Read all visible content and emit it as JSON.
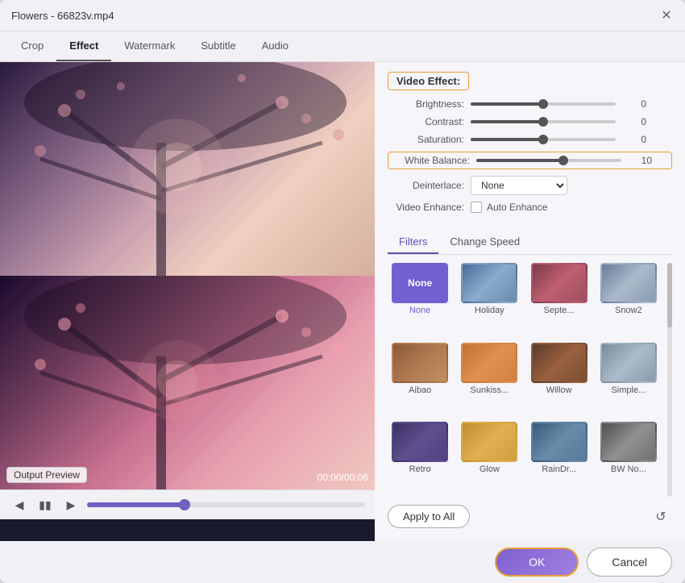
{
  "window": {
    "title": "Flowers - 66823v.mp4"
  },
  "tabs": [
    {
      "id": "crop",
      "label": "Crop",
      "active": false
    },
    {
      "id": "effect",
      "label": "Effect",
      "active": true
    },
    {
      "id": "watermark",
      "label": "Watermark",
      "active": false
    },
    {
      "id": "subtitle",
      "label": "Subtitle",
      "active": false
    },
    {
      "id": "audio",
      "label": "Audio",
      "active": false
    }
  ],
  "video_effect": {
    "section_title": "Video Effect:",
    "brightness": {
      "label": "Brightness:",
      "value": 0,
      "percent": 50
    },
    "contrast": {
      "label": "Contrast:",
      "value": 0,
      "percent": 50
    },
    "saturation": {
      "label": "Saturation:",
      "value": 0,
      "percent": 50
    },
    "white_balance": {
      "label": "White Balance:",
      "value": 10,
      "percent": 60
    },
    "deinterlace": {
      "label": "Deinterlace:",
      "options": [
        "None"
      ],
      "selected": "None"
    },
    "video_enhance": {
      "label": "Video Enhance:",
      "checkbox_label": "Auto Enhance"
    }
  },
  "filters": {
    "tab_filters": "Filters",
    "tab_change_speed": "Change Speed",
    "items": [
      {
        "id": "none",
        "name": "None",
        "selected": true,
        "type": "none"
      },
      {
        "id": "holiday",
        "name": "Holiday",
        "selected": false,
        "type": "holiday"
      },
      {
        "id": "septe",
        "name": "Septe...",
        "selected": false,
        "type": "septe"
      },
      {
        "id": "snow2",
        "name": "Snow2",
        "selected": false,
        "type": "snow2"
      },
      {
        "id": "aibao",
        "name": "Aibao",
        "selected": false,
        "type": "aibao"
      },
      {
        "id": "sunkiss",
        "name": "Sunkiss...",
        "selected": false,
        "type": "sunkiss"
      },
      {
        "id": "willow",
        "name": "Willow",
        "selected": false,
        "type": "willow"
      },
      {
        "id": "simple",
        "name": "Simple...",
        "selected": false,
        "type": "simple"
      },
      {
        "id": "retro",
        "name": "Retro",
        "selected": false,
        "type": "retro"
      },
      {
        "id": "glow",
        "name": "Glow",
        "selected": false,
        "type": "glow"
      },
      {
        "id": "raindr",
        "name": "RainDr...",
        "selected": false,
        "type": "raindr"
      },
      {
        "id": "bwno",
        "name": "BW No...",
        "selected": false,
        "type": "bwno"
      }
    ]
  },
  "preview": {
    "output_label": "Output Preview",
    "timestamp": "00:00/00:06"
  },
  "playback": {
    "prev": "⏮",
    "pause": "⏸",
    "next": "⏭"
  },
  "bottom": {
    "apply_to_all": "Apply to All",
    "ok": "OK",
    "cancel": "Cancel"
  }
}
